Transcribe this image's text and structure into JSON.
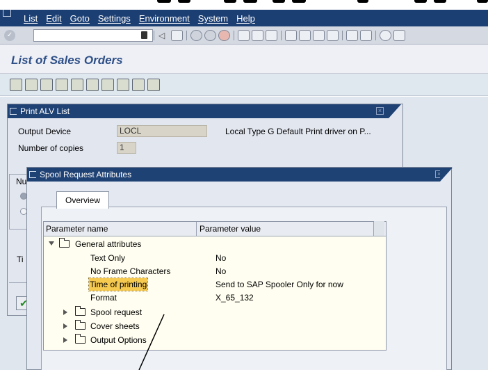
{
  "menubar": {
    "items": [
      "List",
      "Edit",
      "Goto",
      "Settings",
      "Environment",
      "System",
      "Help"
    ]
  },
  "command_field": {
    "value": ""
  },
  "page_title": "List of Sales Orders",
  "print_popup": {
    "title": "Print ALV List",
    "output_device_label": "Output Device",
    "output_device_value": "LOCL",
    "output_device_description": "Local Type G Default Print driver on P...",
    "copies_label": "Number of copies",
    "copies_value": "1",
    "peek_nu": "Nu",
    "peek_ti": "Ti"
  },
  "spool_popup": {
    "title": "Spool Request Attributes",
    "tab_overview": "Overview",
    "columns": [
      "Parameter name",
      "Parameter value"
    ],
    "tree": {
      "general": "General attributes",
      "general_params": [
        {
          "name": "Text Only",
          "value": "No"
        },
        {
          "name": "No Frame Characters",
          "value": "No"
        },
        {
          "name": "Time of printing",
          "value": "Send to SAP Spooler Only for now"
        },
        {
          "name": "Format",
          "value": "X_65_132"
        }
      ],
      "folders": [
        "Spool request",
        "Cover sheets",
        "Output Options"
      ]
    }
  }
}
